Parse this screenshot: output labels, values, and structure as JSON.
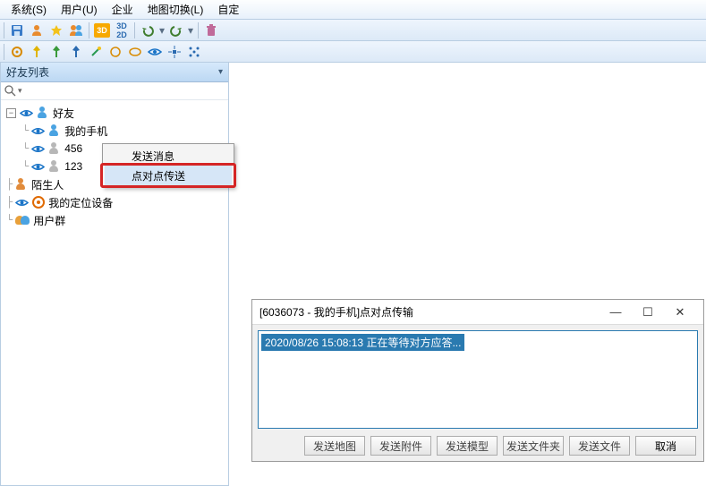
{
  "menubar": {
    "system": "系统(S)",
    "user": "用户(U)",
    "enterprise": "企业",
    "map_switch": "地图切换(L)",
    "auto": "自定"
  },
  "toolbar1": {
    "icons": [
      "save-icon",
      "user-orange-icon",
      "star-icon",
      "users-icon",
      "3d-badge",
      "3d-2d-text",
      "divider",
      "undo-icon",
      "redo-icon",
      "divider",
      "trash-icon"
    ]
  },
  "toolbar2": {
    "icons": [
      "gear-icon",
      "pin-yellow-icon",
      "pin-green-icon",
      "pin-blue-icon",
      "wand-icon",
      "circle-icon",
      "ellipse-icon",
      "eye-open-icon",
      "crosshair-icon",
      "nodes-icon"
    ]
  },
  "panel": {
    "title": "好友列表",
    "search_placeholder": ""
  },
  "tree": {
    "root": {
      "label": "好友"
    },
    "items": [
      {
        "label": "我的手机"
      },
      {
        "label": "456"
      },
      {
        "label": "123"
      }
    ],
    "strangers": "陌生人",
    "my_devices": "我的定位设备",
    "user_groups": "用户群"
  },
  "context_menu": {
    "send_msg": "发送消息",
    "p2p_send": "点对点传送"
  },
  "dialog": {
    "title": "[6036073 - 我的手机]点对点传输",
    "log_line": "2020/08/26 15:08:13 正在等待对方应答...",
    "buttons": {
      "send_map": "发送地图",
      "send_attachment": "发送附件",
      "send_model": "发送模型",
      "send_folder": "发送文件夹",
      "send_file": "发送文件",
      "cancel": "取消"
    }
  },
  "colors": {
    "accent_blue": "#2a7ab0",
    "highlight_red": "#d52525",
    "toolbar_orange": "#f7a900"
  }
}
